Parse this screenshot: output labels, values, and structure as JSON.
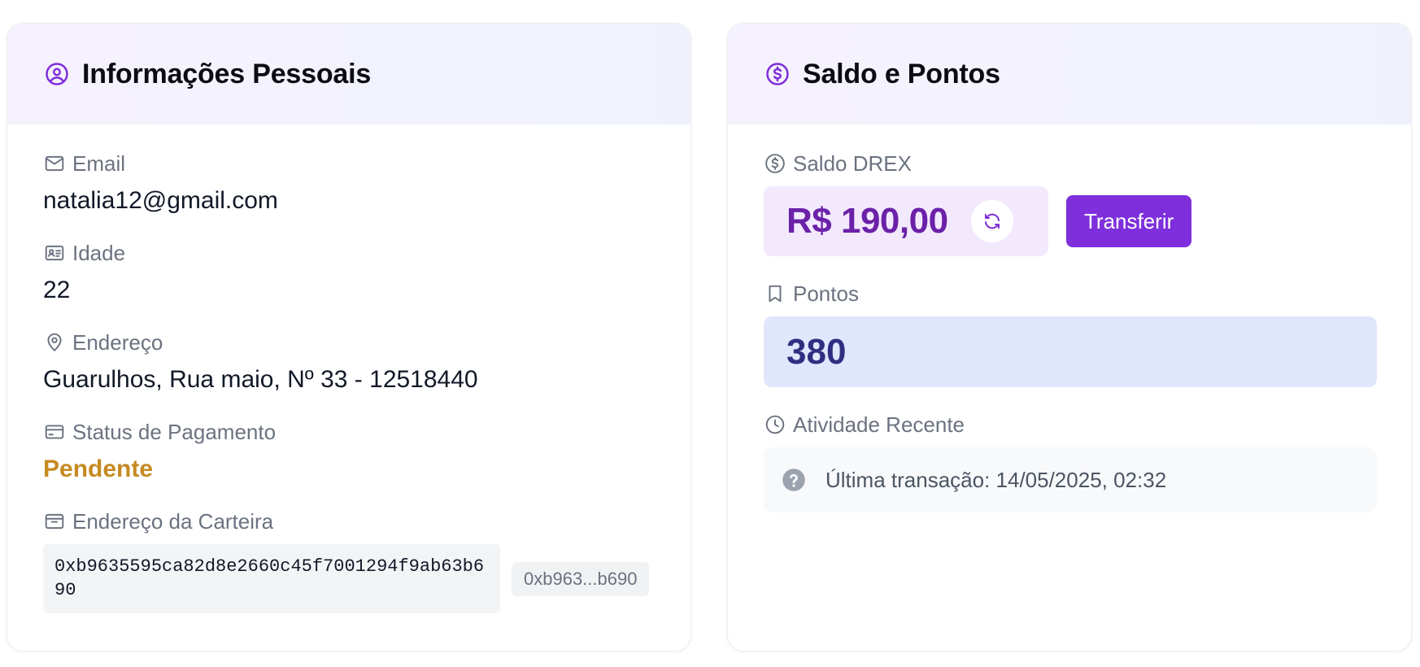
{
  "colors": {
    "accent": "#7e2fdb",
    "pending": "#c68a22",
    "balance_text": "#6b21a8",
    "points_text": "#312e81"
  },
  "personal": {
    "title": "Informações Pessoais",
    "icon": "user-circle-icon",
    "email": {
      "label": "Email",
      "value": "natalia12@gmail.com",
      "icon": "mail-icon"
    },
    "age": {
      "label": "Idade",
      "value": "22",
      "icon": "id-card-icon"
    },
    "address": {
      "label": "Endereço",
      "value": "Guarulhos, Rua maio, Nº 33 - 12518440",
      "icon": "map-pin-icon"
    },
    "payment_status": {
      "label": "Status de Pagamento",
      "value": "Pendente",
      "icon": "credit-card-icon"
    },
    "wallet": {
      "label": "Endereço da Carteira",
      "full": "0xb9635595ca82d8e2660c45f7001294f9ab63b690",
      "short": "0xb963...b690",
      "icon": "wallet-icon"
    }
  },
  "balance": {
    "title": "Saldo e Pontos",
    "icon": "dollar-circle-icon",
    "drex": {
      "label": "Saldo DREX",
      "value": "R$ 190,00",
      "icon": "dollar-circle-icon"
    },
    "refresh_icon": "refresh-icon",
    "transfer_label": "Transferir",
    "points": {
      "label": "Pontos",
      "value": "380",
      "icon": "bookmark-icon"
    },
    "activity": {
      "label": "Atividade Recente",
      "icon": "clock-icon",
      "text": "Última transação: 14/05/2025, 02:32",
      "status_icon": "question-circle-icon"
    }
  }
}
